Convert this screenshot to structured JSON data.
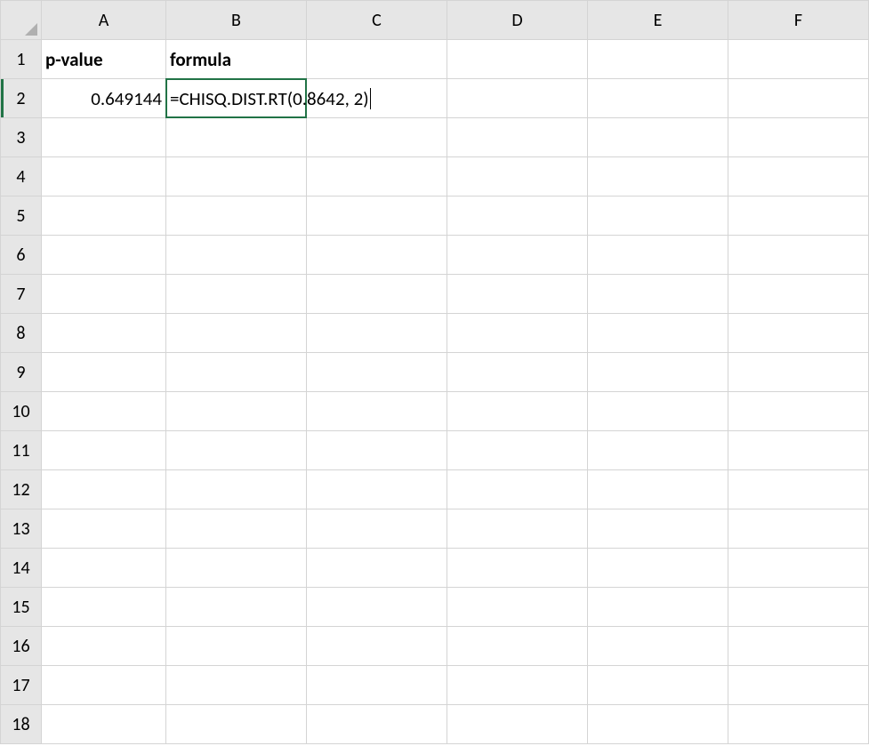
{
  "colors": {
    "grid": "#d4d4d4",
    "header_bg": "#e6e6e6",
    "accent": "#217346"
  },
  "columns": [
    "A",
    "B",
    "C",
    "D",
    "E",
    "F"
  ],
  "row_count": 18,
  "headers": {
    "A1": "p-value",
    "B1": "formula"
  },
  "cells": {
    "A2": "0.649144",
    "B2": "=CHISQ.DIST.RT(0.8642, 2)"
  },
  "active_cell": "B2"
}
